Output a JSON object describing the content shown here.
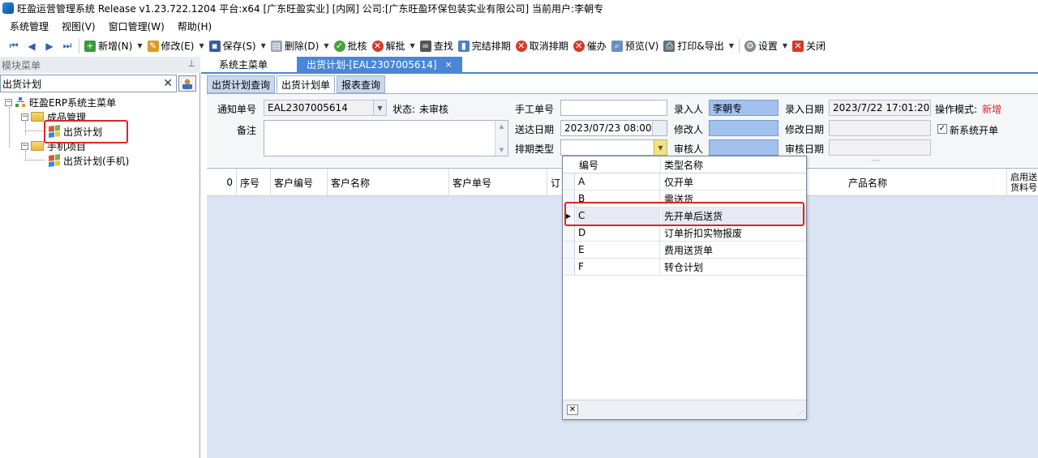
{
  "window": {
    "title": "旺盈运营管理系统 Release v1.23.722.1204 平台:x64  [广东旺盈实业] [内网] 公司:[广东旺盈环保包装实业有限公司] 当前用户:李朝专"
  },
  "menu": [
    "系统管理",
    "视图(V)",
    "窗口管理(W)",
    "帮助(H)"
  ],
  "toolbar": {
    "nav_first": "⏮",
    "nav_prev": "◀",
    "nav_next": "▶",
    "nav_last": "⏭",
    "add": "新增(N)",
    "edit": "修改(E)",
    "save": "保存(S)",
    "delete": "删除(D)",
    "approve": "批核",
    "unapprove": "解批",
    "find": "查找",
    "finish": "完结排期",
    "cancel_finish": "取消排期",
    "remind": "催办",
    "preview": "预览(V)",
    "print_export": "打印&导出",
    "settings": "设置",
    "close": "关闭"
  },
  "left_panel": {
    "header": "模块菜单",
    "search_value": "出货计划",
    "tree": {
      "root": "旺盈ERP系统主菜单",
      "group1": "成品管理",
      "group1_item": "出货计划",
      "group2": "手机项目",
      "group2_item": "出货计划(手机)"
    }
  },
  "tabs": {
    "main_menu": "系统主菜单",
    "active": "出货计划-[EAL2307005614]",
    "active_close": "×"
  },
  "inner_tabs": [
    "出货计划查询",
    "出货计划单",
    "报表查询"
  ],
  "form": {
    "notice_no_label": "通知单号",
    "notice_no": "EAL2307005614",
    "status_label": "状态:",
    "status": "未审核",
    "manual_no_label": "手工单号",
    "manual_no": "",
    "entered_by_label": "录入人",
    "entered_by": "李朝专",
    "entry_date_label": "录入日期",
    "entry_date": "2023/7/22 17:01:20",
    "mode_label": "操作模式:",
    "mode": "新增",
    "remark_label": "备注",
    "deliver_date_label": "送达日期",
    "deliver_date": "2023/07/23 08:00",
    "modified_by_label": "修改人",
    "modify_date_label": "修改日期",
    "new_system_label": "新系统开单",
    "new_system_checked": "✓",
    "schedule_type_label": "排期类型",
    "schedule_type": "",
    "reviewer_label": "审核人",
    "review_date_label": "审核日期",
    "splitter_dots": "····"
  },
  "grid": {
    "columns": [
      "0",
      "序号",
      "客户编号",
      "客户名称",
      "客户单号",
      "订",
      "产品名称",
      "启用送货料号"
    ]
  },
  "popup": {
    "col_code": "编号",
    "col_name": "类型名称",
    "rows": [
      {
        "code": "A",
        "name": "仅开单"
      },
      {
        "code": "B",
        "name": "需送货"
      },
      {
        "code": "C",
        "name": "先开单后送货"
      },
      {
        "code": "D",
        "name": "订单折扣实物报废"
      },
      {
        "code": "E",
        "name": "费用送货单"
      },
      {
        "code": "F",
        "name": "转仓计划"
      }
    ],
    "selected_index": 2,
    "close_glyph": "✕"
  },
  "colors": {
    "accent_tab": "#4a86d6",
    "highlight_box": "#e02424",
    "blue_field": "#a3c1ef",
    "mode_text": "#e02424"
  }
}
